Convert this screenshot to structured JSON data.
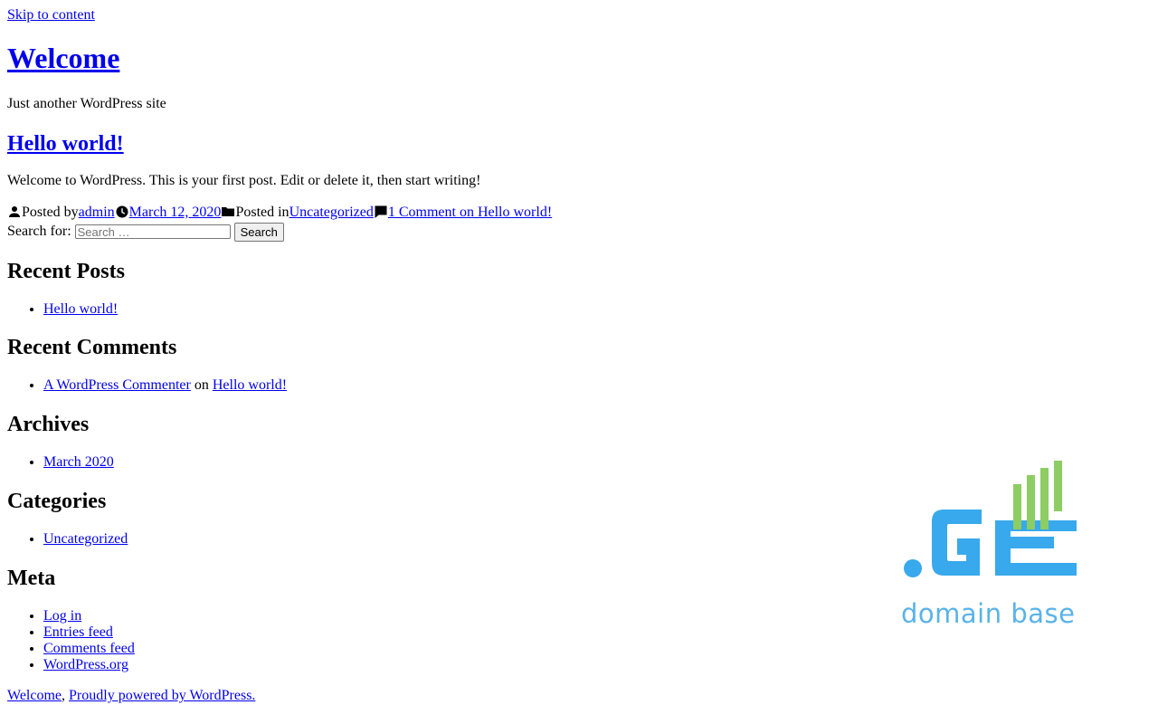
{
  "skip_link": "Skip to content",
  "site": {
    "title": "Welcome",
    "description": "Just another WordPress site"
  },
  "post": {
    "title": "Hello world!",
    "excerpt": "Welcome to WordPress. This is your first post. Edit or delete it, then start writing!",
    "meta": {
      "posted_by_label": "Posted by",
      "author": "admin",
      "date": "March 12, 2020",
      "posted_in_label": "Posted in",
      "category": "Uncategorized",
      "comments_link": "1 Comment on Hello world!"
    }
  },
  "search": {
    "label": "Search for:",
    "placeholder": "Search …",
    "value": "",
    "button_label": "Search"
  },
  "widgets": {
    "recent_posts": {
      "title": "Recent Posts",
      "items": [
        "Hello world!"
      ]
    },
    "recent_comments": {
      "title": "Recent Comments",
      "items": [
        {
          "author": "A WordPress Commenter",
          "connector": "on",
          "post": "Hello world!"
        }
      ]
    },
    "archives": {
      "title": "Archives",
      "items": [
        "March 2020"
      ]
    },
    "categories": {
      "title": "Categories",
      "items": [
        "Uncategorized"
      ]
    },
    "meta": {
      "title": "Meta",
      "items": [
        "Log in",
        "Entries feed",
        "Comments feed",
        "WordPress.org"
      ]
    }
  },
  "logo": {
    "text": "domain base",
    "blue": "#38a9ec",
    "green": "#8dcd63"
  },
  "footer": {
    "site_link": "Welcome",
    "separator": ",",
    "powered_link": "Proudly powered by WordPress."
  },
  "icons": {
    "author": "person-icon",
    "date": "clock-icon",
    "category": "folder-icon",
    "comments": "comment-icon"
  },
  "colors": {
    "link": "#0000ee",
    "text": "#000000",
    "background": "#ffffff"
  }
}
